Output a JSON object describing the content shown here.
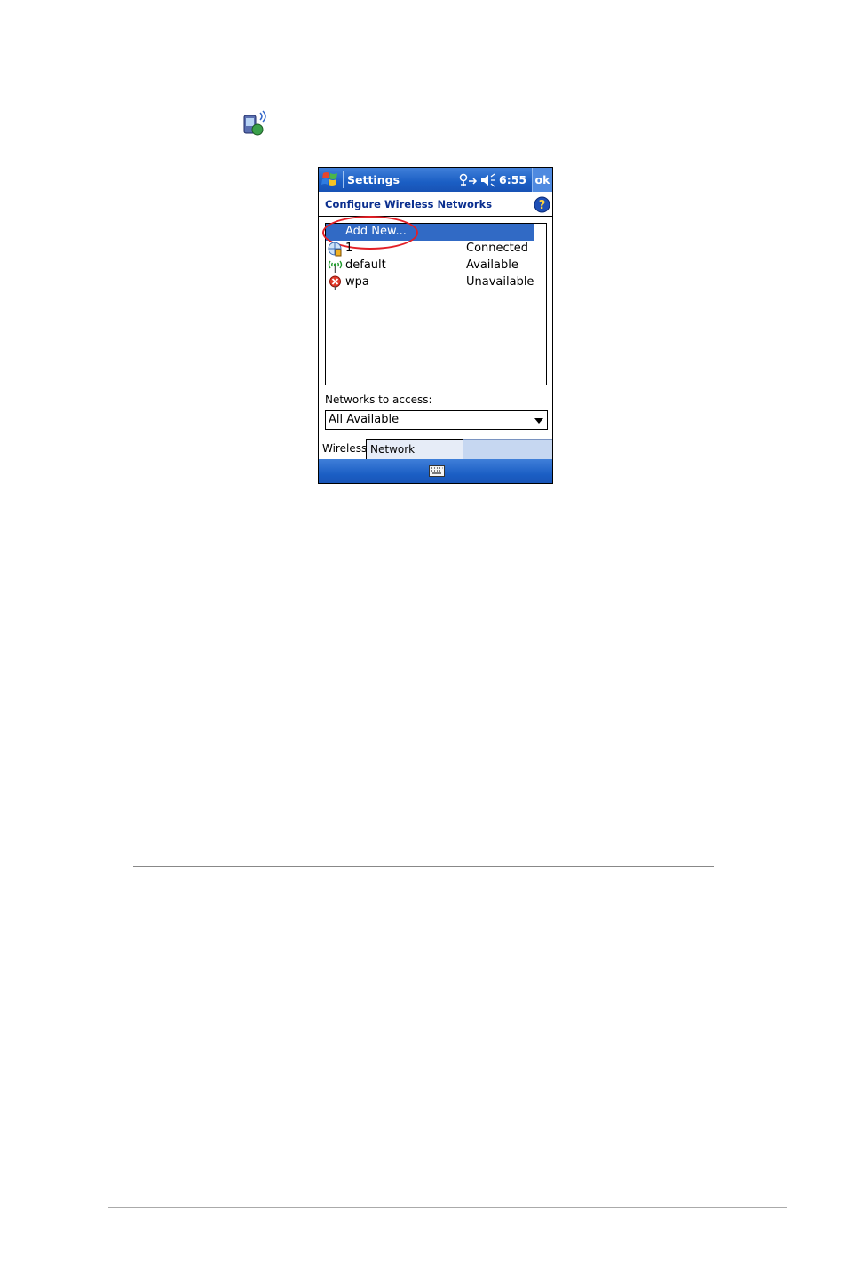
{
  "icons": {
    "page_icon": "connections-icon",
    "start": "windows-start-icon",
    "connectivity": "connectivity-icon",
    "volume": "volume-icon",
    "help": "help-icon",
    "keyboard": "keyboard-icon"
  },
  "titlebar": {
    "app_title": "Settings",
    "time": "6:55",
    "ok_label": "ok"
  },
  "header": {
    "title": "Configure Wireless Networks"
  },
  "networks": {
    "add_new_label": "Add New...",
    "items": [
      {
        "name": "1",
        "status": "Connected",
        "icon": "connected-network-icon"
      },
      {
        "name": "default",
        "status": "Available",
        "icon": "available-network-icon"
      },
      {
        "name": "wpa",
        "status": "Unavailable",
        "icon": "unavailable-network-icon"
      }
    ]
  },
  "access": {
    "label": "Networks to access:",
    "selected": "All Available"
  },
  "tabs": [
    {
      "label": "Wireless",
      "active": true
    },
    {
      "label": "Network Adapters",
      "active": false
    }
  ],
  "colors": {
    "titlebar": "#1b5ec4",
    "selection": "#316ac5",
    "annotation": "#e21f26"
  }
}
